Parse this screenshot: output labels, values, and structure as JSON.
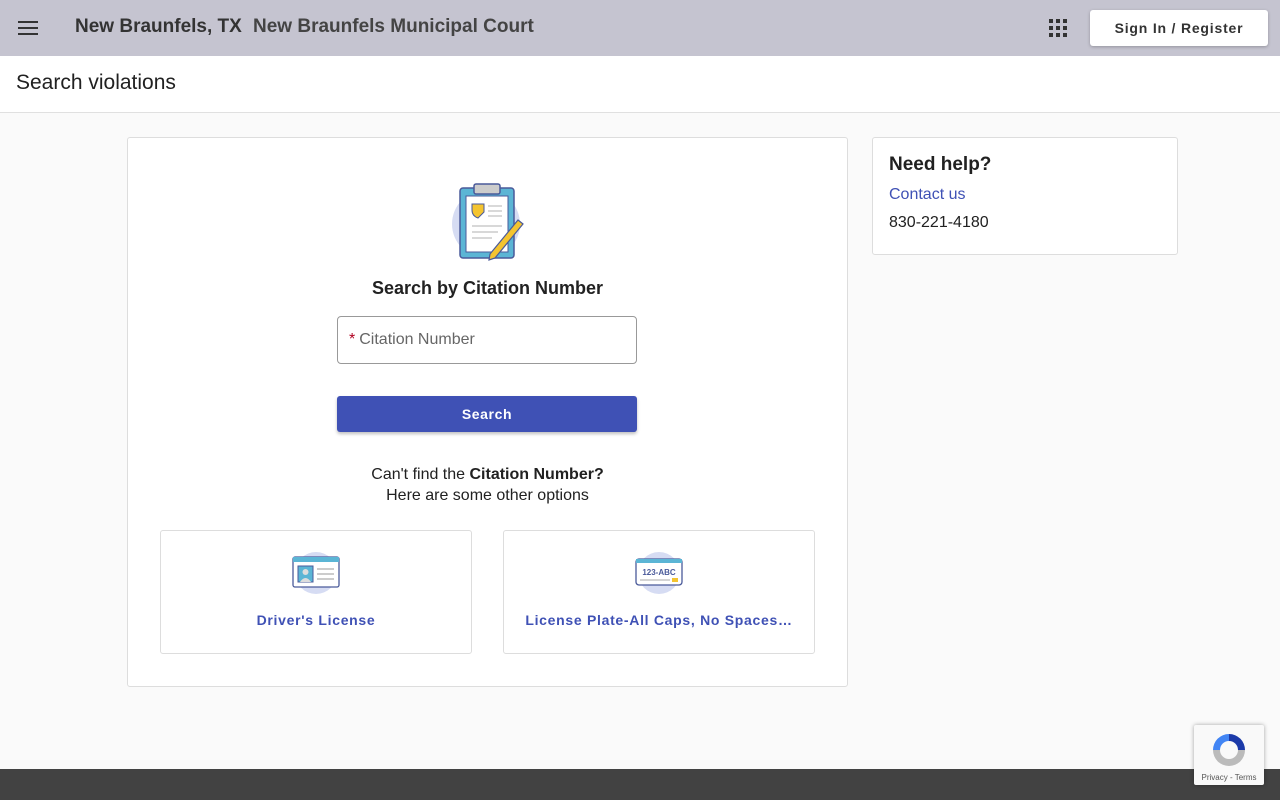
{
  "header": {
    "location": "New Braunfels, TX",
    "court": "New Braunfels Municipal Court",
    "sign_in": "Sign In / Register"
  },
  "page": {
    "title": "Search violations"
  },
  "search": {
    "heading": "Search by Citation Number",
    "required_mark": "*",
    "placeholder": "Citation Number",
    "button": "Search",
    "cant_find_prefix": "Can't find the ",
    "cant_find_bold": "Citation Number?",
    "other_options": "Here are some other options",
    "options": [
      {
        "label": "Driver's License"
      },
      {
        "label": "License Plate-All Caps, No Spaces…",
        "plate_text": "123-ABC"
      }
    ]
  },
  "help": {
    "title": "Need help?",
    "contact": "Contact us",
    "phone": "830-221-4180"
  },
  "recaptcha": {
    "privacy": "Privacy",
    "sep": " - ",
    "terms": "Terms"
  },
  "colors": {
    "accent": "#3f51b5",
    "topbar": "#c5c4d0",
    "footer": "#424242"
  }
}
